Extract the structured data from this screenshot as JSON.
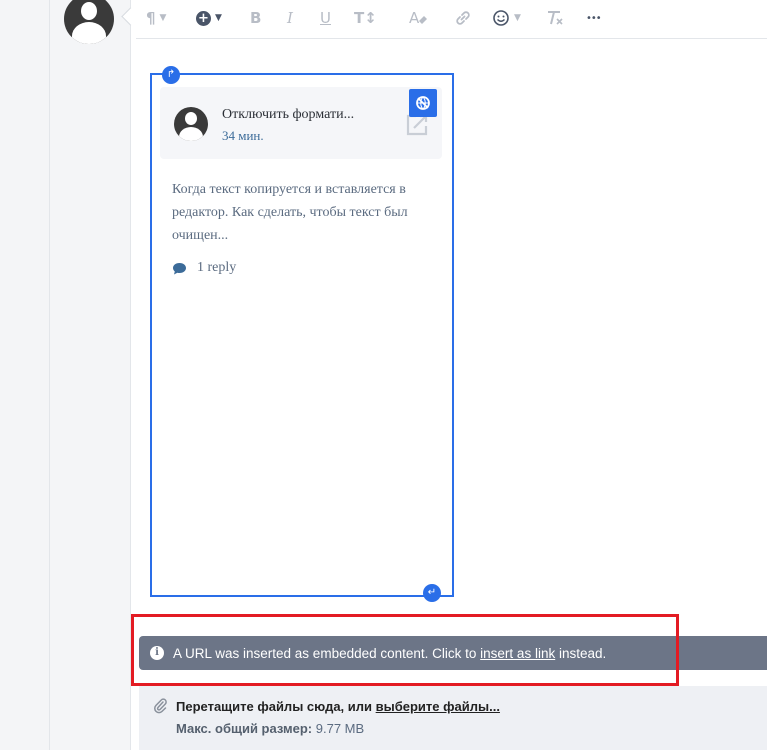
{
  "toolbar": {
    "icons": [
      "paragraph-icon",
      "insert-icon",
      "bold-icon",
      "italic-icon",
      "underline-icon",
      "font-size-icon",
      "clear-color-icon",
      "link-icon",
      "emoji-icon",
      "remove-format-icon",
      "more-icon"
    ],
    "paragraph_glyph": "¶",
    "insert_glyph": "+",
    "bold_glyph": "B",
    "italic_glyph": "I",
    "underline_glyph": "U",
    "font_size_glyph": "T↕",
    "more_glyph": "•••"
  },
  "embed": {
    "title": "Отключить формати...",
    "time": "34 мин.",
    "excerpt": "Когда текст копируется и вставляется в редактор. Как сделать, чтобы текст был очищен...",
    "reply_label": "1 reply"
  },
  "notice": {
    "text_before": "A URL was inserted as embedded content. Click to ",
    "link_label": "insert as link",
    "text_after": " instead."
  },
  "upload": {
    "drag_text": "Перетащите файлы сюда, или ",
    "choose_label": "выберите файлы...",
    "max_label": "Макс. общий размер:",
    "max_value": " 9.77 MB"
  },
  "colors": {
    "accent": "#2a6ee8",
    "notice_bg": "#6c7587",
    "highlight_frame": "#e31b23"
  }
}
